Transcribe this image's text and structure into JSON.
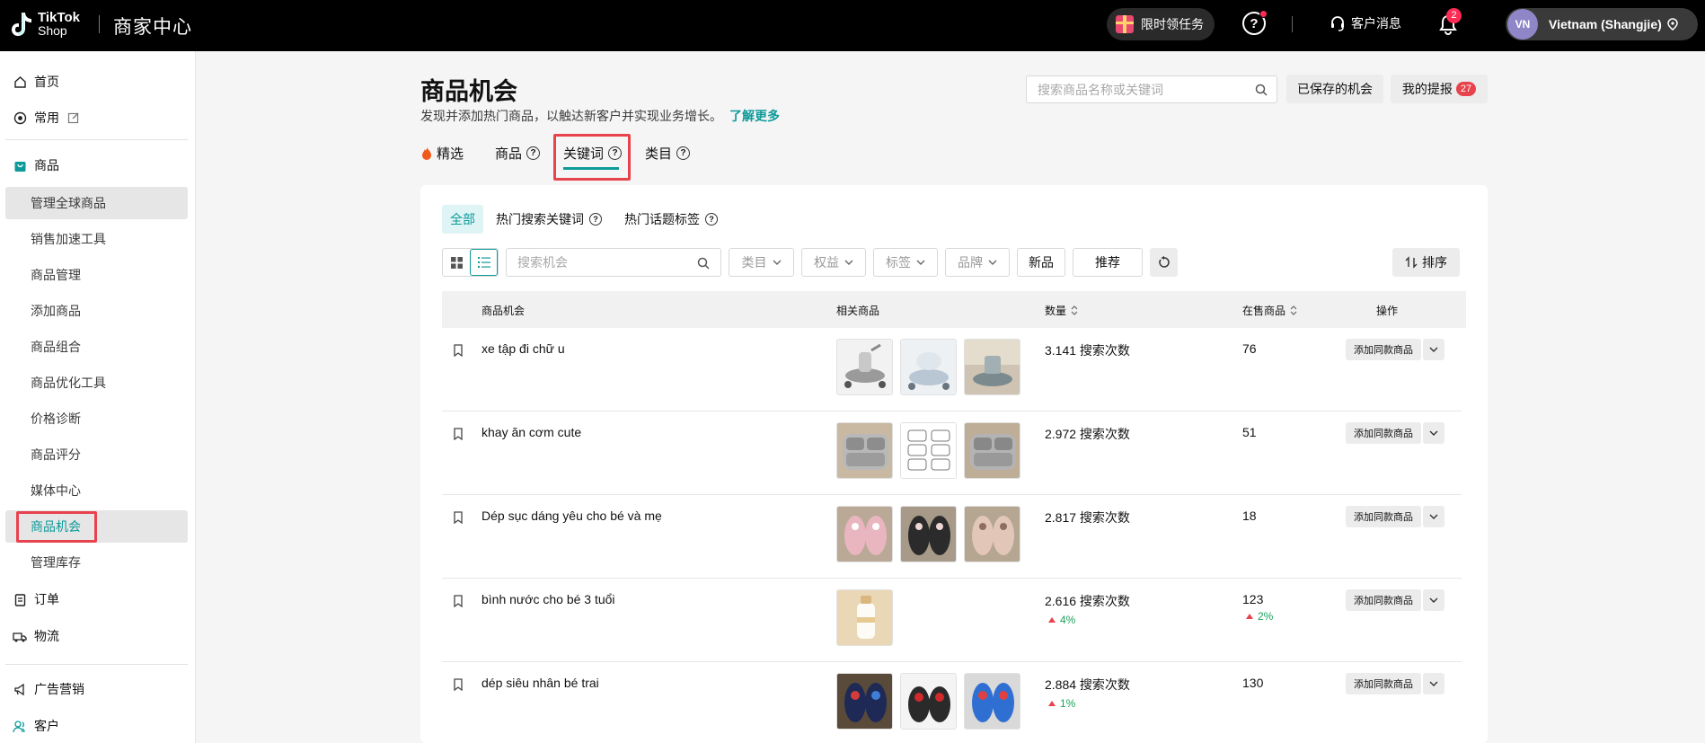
{
  "topbar": {
    "logo_line1": "TikTok",
    "logo_line2": "Shop",
    "center_title": "商家中心",
    "task_label": "限时领任务",
    "cs_label": "客户消息",
    "bell_count": "2",
    "avatar_initials": "VN",
    "account_name": "Vietnam (Shangjie)"
  },
  "sidebar": {
    "home": "首页",
    "common": "常用",
    "products": "商品",
    "sub_items": [
      "管理全球商品",
      "销售加速工具",
      "商品管理",
      "添加商品",
      "商品组合",
      "商品优化工具",
      "价格诊断",
      "商品评分",
      "媒体中心",
      "商品机会",
      "管理库存"
    ],
    "orders": "订单",
    "logistics": "物流",
    "ads": "广告营销",
    "customers": "客户"
  },
  "header": {
    "title": "商品机会",
    "desc": "发现并添加热门商品，以触达新客户并实现业务增长。",
    "learn_more": "了解更多",
    "search_placeholder": "搜索商品名称或关键词",
    "saved_btn": "已保存的机会",
    "proposals_btn": "我的提报",
    "proposals_count": "27"
  },
  "tabs": {
    "featured": "精选",
    "products": "商品",
    "keywords": "关键词",
    "categories": "类目"
  },
  "subtabs": {
    "all": "全部",
    "hot_search": "热门搜索关键词",
    "hot_topic": "热门话题标签"
  },
  "filters": {
    "search_placeholder": "搜索机会",
    "category": "类目",
    "benefit": "权益",
    "tag": "标签",
    "brand": "品牌",
    "new": "新品",
    "recommend": "推荐",
    "sort": "排序"
  },
  "table": {
    "headers": {
      "opportunity": "商品机会",
      "related": "相关商品",
      "quantity": "数量",
      "on_sale": "在售商品",
      "action": "操作"
    },
    "action_label": "添加同款商品",
    "rows": [
      {
        "keyword": "xe tập đi chữ u",
        "count": "3.141 搜索次数",
        "count_trend": "",
        "on_sale": "76",
        "sale_trend": "",
        "thumbs": [
          "walker-grey-icon",
          "walker-round-icon",
          "walker-room-icon"
        ]
      },
      {
        "keyword": "khay ăn cơm cute",
        "count": "2.972 搜索次数",
        "count_trend": "",
        "on_sale": "51",
        "sale_trend": "",
        "thumbs": [
          "tray-steel-icon",
          "tray-grid-icon",
          "tray-steel-icon"
        ]
      },
      {
        "keyword": "Dép sục dáng yêu cho bé và mẹ",
        "count": "2.817 搜索次数",
        "count_trend": "",
        "on_sale": "18",
        "sale_trend": "",
        "thumbs": [
          "clog-pink-icon",
          "clog-black-icon",
          "clog-pink-icon"
        ]
      },
      {
        "keyword": "bình nước cho bé 3 tuổi",
        "count": "2.616 搜索次数",
        "count_trend": "4%",
        "on_sale": "123",
        "sale_trend": "2%",
        "thumbs": [
          "bottle-icon"
        ]
      },
      {
        "keyword": "dép siêu nhân bé trai",
        "count": "2.884 搜索次数",
        "count_trend": "1%",
        "on_sale": "130",
        "sale_trend": "",
        "thumbs": [
          "sandal-hero-icon",
          "sandal-red-icon",
          "sandal-blue-icon"
        ]
      }
    ]
  },
  "colors": {
    "accent": "#0d9a9a",
    "highlight": "#e8424d",
    "trend_up": "#19a35b"
  }
}
